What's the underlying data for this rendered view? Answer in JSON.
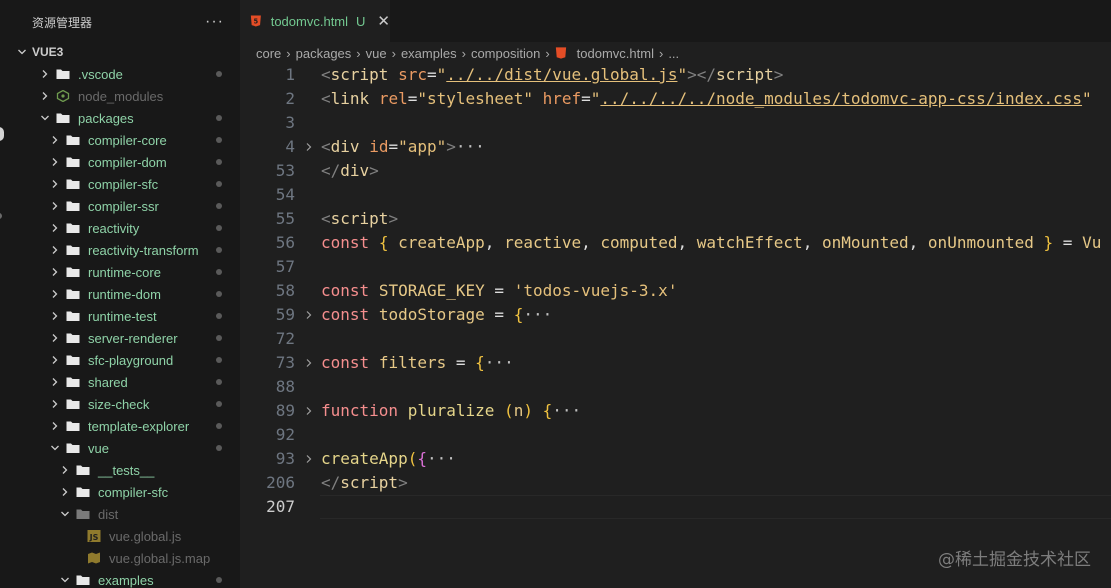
{
  "sidebar": {
    "title": "资源管理器",
    "more": "···",
    "items": [
      {
        "label": "VUE3",
        "depth": 0,
        "kind": "root",
        "open": true
      },
      {
        "label": ".vscode",
        "depth": 1,
        "kind": "folder",
        "open": false,
        "dot": true
      },
      {
        "label": "node_modules",
        "depth": 1,
        "kind": "node",
        "open": false,
        "dim": true
      },
      {
        "label": "packages",
        "depth": 1,
        "kind": "folder",
        "open": true,
        "dot": true
      },
      {
        "label": "compiler-core",
        "depth": 2,
        "kind": "folder",
        "open": false,
        "dot": true
      },
      {
        "label": "compiler-dom",
        "depth": 2,
        "kind": "folder",
        "open": false,
        "dot": true
      },
      {
        "label": "compiler-sfc",
        "depth": 2,
        "kind": "folder",
        "open": false,
        "dot": true
      },
      {
        "label": "compiler-ssr",
        "depth": 2,
        "kind": "folder",
        "open": false,
        "dot": true
      },
      {
        "label": "reactivity",
        "depth": 2,
        "kind": "folder",
        "open": false,
        "dot": true
      },
      {
        "label": "reactivity-transform",
        "depth": 2,
        "kind": "folder",
        "open": false,
        "dot": true
      },
      {
        "label": "runtime-core",
        "depth": 2,
        "kind": "folder",
        "open": false,
        "dot": true
      },
      {
        "label": "runtime-dom",
        "depth": 2,
        "kind": "folder",
        "open": false,
        "dot": true
      },
      {
        "label": "runtime-test",
        "depth": 2,
        "kind": "folder",
        "open": false,
        "dot": true
      },
      {
        "label": "server-renderer",
        "depth": 2,
        "kind": "folder",
        "open": false,
        "dot": true
      },
      {
        "label": "sfc-playground",
        "depth": 2,
        "kind": "folder",
        "open": false,
        "dot": true
      },
      {
        "label": "shared",
        "depth": 2,
        "kind": "folder",
        "open": false,
        "dot": true
      },
      {
        "label": "size-check",
        "depth": 2,
        "kind": "folder",
        "open": false,
        "dot": true
      },
      {
        "label": "template-explorer",
        "depth": 2,
        "kind": "folder",
        "open": false,
        "dot": true
      },
      {
        "label": "vue",
        "depth": 2,
        "kind": "folder",
        "open": true,
        "dot": true
      },
      {
        "label": "__tests__",
        "depth": 3,
        "kind": "folder",
        "open": false
      },
      {
        "label": "compiler-sfc",
        "depth": 3,
        "kind": "folder",
        "open": false
      },
      {
        "label": "dist",
        "depth": 3,
        "kind": "folder",
        "open": true,
        "dim": true
      },
      {
        "label": "vue.global.js",
        "depth": 4,
        "kind": "js",
        "dim": true
      },
      {
        "label": "vue.global.js.map",
        "depth": 4,
        "kind": "map",
        "dim": true
      },
      {
        "label": "examples",
        "depth": 3,
        "kind": "folder",
        "open": true,
        "dot": true
      }
    ]
  },
  "tab": {
    "filename": "todomvc.html",
    "status": "U",
    "close": "✕"
  },
  "breadcrumb": [
    "core",
    "packages",
    "vue",
    "examples",
    "composition",
    "todomvc.html",
    "..."
  ],
  "code": [
    {
      "n": "1",
      "fold": false,
      "tokens": [
        [
          "t-tag",
          "<"
        ],
        [
          "t-el",
          "script"
        ],
        [
          "t-op",
          " "
        ],
        [
          "t-attr",
          "src"
        ],
        [
          "t-op",
          "="
        ],
        [
          "t-str",
          "\""
        ],
        [
          "t-link",
          "../../dist/vue.global.js"
        ],
        [
          "t-str",
          "\""
        ],
        [
          "t-tag",
          "></"
        ],
        [
          "t-el",
          "script"
        ],
        [
          "t-tag",
          ">"
        ]
      ]
    },
    {
      "n": "2",
      "fold": false,
      "tokens": [
        [
          "t-tag",
          "<"
        ],
        [
          "t-el",
          "link"
        ],
        [
          "t-op",
          " "
        ],
        [
          "t-attr",
          "rel"
        ],
        [
          "t-op",
          "="
        ],
        [
          "t-str",
          "\"stylesheet\""
        ],
        [
          "t-op",
          " "
        ],
        [
          "t-attr",
          "href"
        ],
        [
          "t-op",
          "="
        ],
        [
          "t-str",
          "\""
        ],
        [
          "t-link",
          "../../../../node_modules/todomvc-app-css/index.css"
        ],
        [
          "t-str",
          "\""
        ]
      ]
    },
    {
      "n": "3",
      "fold": false,
      "tokens": []
    },
    {
      "n": "4",
      "fold": true,
      "tokens": [
        [
          "t-tag",
          "<"
        ],
        [
          "t-el",
          "div"
        ],
        [
          "t-op",
          " "
        ],
        [
          "t-attr",
          "id"
        ],
        [
          "t-op",
          "="
        ],
        [
          "t-str",
          "\"app\""
        ],
        [
          "t-tag",
          ">"
        ],
        [
          "t-dim",
          "···"
        ]
      ]
    },
    {
      "n": "53",
      "fold": false,
      "tokens": [
        [
          "t-tag",
          "</"
        ],
        [
          "t-el",
          "div"
        ],
        [
          "t-tag",
          ">"
        ]
      ]
    },
    {
      "n": "54",
      "fold": false,
      "tokens": []
    },
    {
      "n": "55",
      "fold": false,
      "tokens": [
        [
          "t-tag",
          "<"
        ],
        [
          "t-el",
          "script"
        ],
        [
          "t-tag",
          ">"
        ]
      ]
    },
    {
      "n": "56",
      "fold": false,
      "tokens": [
        [
          "t-kw",
          "const"
        ],
        [
          "t-op",
          " "
        ],
        [
          "t-br",
          "{"
        ],
        [
          "t-op",
          " "
        ],
        [
          "t-id",
          "createApp"
        ],
        [
          "t-op",
          ", "
        ],
        [
          "t-id",
          "reactive"
        ],
        [
          "t-op",
          ", "
        ],
        [
          "t-id",
          "computed"
        ],
        [
          "t-op",
          ", "
        ],
        [
          "t-id",
          "watchEffect"
        ],
        [
          "t-op",
          ", "
        ],
        [
          "t-id",
          "onMounted"
        ],
        [
          "t-op",
          ", "
        ],
        [
          "t-id",
          "onUnmounted"
        ],
        [
          "t-op",
          " "
        ],
        [
          "t-br",
          "}"
        ],
        [
          "t-op",
          " = "
        ],
        [
          "t-id",
          "Vu"
        ]
      ]
    },
    {
      "n": "57",
      "fold": false,
      "tokens": []
    },
    {
      "n": "58",
      "fold": false,
      "tokens": [
        [
          "t-kw",
          "const"
        ],
        [
          "t-op",
          " "
        ],
        [
          "t-id",
          "STORAGE_KEY"
        ],
        [
          "t-op",
          " = "
        ],
        [
          "t-str",
          "'todos-vuejs-3.x'"
        ]
      ]
    },
    {
      "n": "59",
      "fold": true,
      "tokens": [
        [
          "t-kw",
          "const"
        ],
        [
          "t-op",
          " "
        ],
        [
          "t-id",
          "todoStorage"
        ],
        [
          "t-op",
          " = "
        ],
        [
          "t-br",
          "{"
        ],
        [
          "t-dim",
          "···"
        ]
      ]
    },
    {
      "n": "72",
      "fold": false,
      "tokens": []
    },
    {
      "n": "73",
      "fold": true,
      "tokens": [
        [
          "t-kw",
          "const"
        ],
        [
          "t-op",
          " "
        ],
        [
          "t-id",
          "filters"
        ],
        [
          "t-op",
          " = "
        ],
        [
          "t-br",
          "{"
        ],
        [
          "t-dim",
          "···"
        ]
      ]
    },
    {
      "n": "88",
      "fold": false,
      "tokens": []
    },
    {
      "n": "89",
      "fold": true,
      "tokens": [
        [
          "t-kw",
          "function"
        ],
        [
          "t-op",
          " "
        ],
        [
          "t-fn",
          "pluralize"
        ],
        [
          "t-op",
          " "
        ],
        [
          "t-br",
          "("
        ],
        [
          "t-id",
          "n"
        ],
        [
          "t-br",
          ")"
        ],
        [
          "t-op",
          " "
        ],
        [
          "t-br",
          "{"
        ],
        [
          "t-dim",
          "···"
        ]
      ]
    },
    {
      "n": "92",
      "fold": false,
      "tokens": []
    },
    {
      "n": "93",
      "fold": true,
      "tokens": [
        [
          "t-fn",
          "createApp"
        ],
        [
          "t-br",
          "("
        ],
        [
          "t-br2",
          "{"
        ],
        [
          "t-dim",
          "···"
        ]
      ]
    },
    {
      "n": "206",
      "fold": false,
      "tokens": [
        [
          "t-tag",
          "</"
        ],
        [
          "t-el",
          "script"
        ],
        [
          "t-tag",
          ">"
        ]
      ]
    },
    {
      "n": "207",
      "fold": false,
      "active": true,
      "tokens": []
    }
  ],
  "watermark": "@稀土掘金技术社区"
}
